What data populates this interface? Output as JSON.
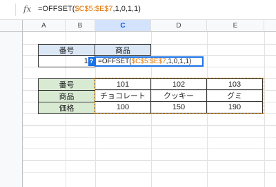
{
  "formula_bar": {
    "fx_label": "fx",
    "prefix": "=OFFSET(",
    "range": "$C$5:$E$7",
    "suffix": ",1,0,1,1)"
  },
  "columns": [
    "A",
    "B",
    "C",
    "D",
    "E"
  ],
  "selected_column": "C",
  "lookup": {
    "header_left": "番号",
    "header_right": "商品",
    "value": "10",
    "editor_prefix": "=OFFSET(",
    "editor_range": "$C$5:$E$7",
    "editor_suffix": ",1,0,1,1)",
    "hint_icon": "?"
  },
  "table": {
    "row_labels": [
      "番号",
      "商品",
      "価格"
    ],
    "rows": [
      [
        "101",
        "102",
        "103"
      ],
      [
        "チョコレート",
        "クッキー",
        "グミ"
      ],
      [
        "100",
        "150",
        "190"
      ]
    ]
  },
  "colors": {
    "accent": "#1a73e8",
    "range_highlight": "#f29900",
    "header_green": "#d9ead3",
    "header_blue": "#dbe7f4"
  }
}
